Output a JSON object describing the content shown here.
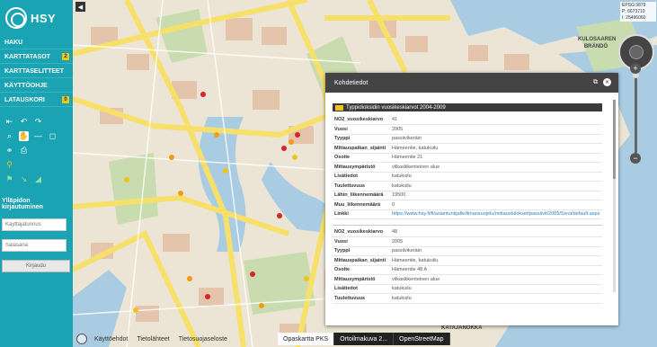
{
  "app": {
    "logo_text": "HSY"
  },
  "menu": [
    {
      "label": "HAKU",
      "badge": ""
    },
    {
      "label": "KARTTATASOT",
      "badge": "2"
    },
    {
      "label": "KARTTASELITTEET",
      "badge": ""
    },
    {
      "label": "KÄYTTÖOHJE",
      "badge": ""
    },
    {
      "label": "LATAUSKORI",
      "badge": "0"
    }
  ],
  "login": {
    "title": "Ylläpidon kirjautuminen",
    "username_placeholder": "Käyttäjätunnus",
    "password_placeholder": "Salasana",
    "button": "Kirjaudu"
  },
  "map": {
    "coords": {
      "epsg": "EPSG:3879",
      "p_label": "P:",
      "p_value": "6673710",
      "i_label": "I:",
      "i_value": "25496060"
    },
    "place_labels": [
      "KULOSAAREN BRÄNDÖ",
      "KATAJANOKKA"
    ]
  },
  "footer": {
    "links": [
      "Käyttöehdot",
      "Tietolähteet",
      "Tietosuojaseloste"
    ]
  },
  "layer_tabs": [
    {
      "label": "Opaskartta PKS",
      "active": true
    },
    {
      "label": "Ortoilmakuva 2...",
      "active": false
    },
    {
      "label": "OpenStreetMap",
      "active": false
    }
  ],
  "panel": {
    "title": "Kohdetiedot",
    "layer_name": "Typpidioksidin vuosikeskiarvot 2004-2009",
    "layer_color": "#f0c419",
    "records": [
      [
        {
          "k": "NO2_vuosikeskiarvo",
          "v": "41"
        },
        {
          "k": "Vuosi",
          "v": "2005"
        },
        {
          "k": "Tyyppi",
          "v": "passiivikeräin"
        },
        {
          "k": "Mittauspaikan_sijainti",
          "v": "Hämeentie, katukuilu"
        },
        {
          "k": "Osoite",
          "v": "Hämeentie 21"
        },
        {
          "k": "Mittausympäristö",
          "v": "vilkasliikenteinen alue"
        },
        {
          "k": "Lisätiedot",
          "v": "katukuilu"
        },
        {
          "k": "Tuulettuvuus",
          "v": "katukuilu"
        },
        {
          "k": "Lähin_liikennemäärä",
          "v": "19500"
        },
        {
          "k": "Muu_liikennemäärä",
          "v": "0"
        },
        {
          "k": "Linkki",
          "v": "https://www.hsy.fi/fi/asiantuntijalle/ilmansuojelu/mittaustulokset/passiivit/2005/Sivut/default.aspx",
          "link": true
        }
      ],
      [
        {
          "k": "NO2_vuosikeskiarvo",
          "v": "48"
        },
        {
          "k": "Vuosi",
          "v": "2005"
        },
        {
          "k": "Tyyppi",
          "v": "passiivikeräin"
        },
        {
          "k": "Mittauspaikan_sijainti",
          "v": "Hämeentie, katukuilu"
        },
        {
          "k": "Osoite",
          "v": "Hämeentie 48 A"
        },
        {
          "k": "Mittausympäristö",
          "v": "vilkasliikenteinen alue"
        },
        {
          "k": "Lisätiedot",
          "v": "katukuilu"
        },
        {
          "k": "Tuulettuvuus",
          "v": "katukuilu"
        }
      ]
    ]
  }
}
